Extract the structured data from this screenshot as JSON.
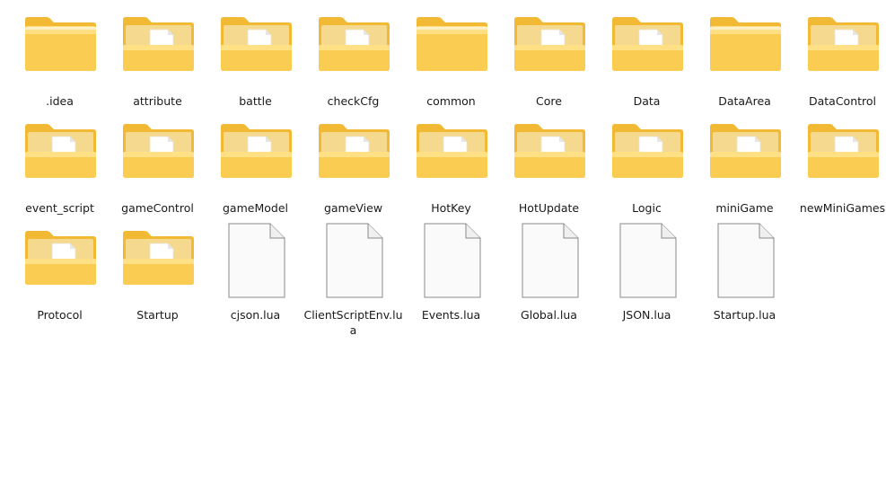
{
  "items": [
    {
      "name": ".idea",
      "type": "folder-empty"
    },
    {
      "name": "attribute",
      "type": "folder"
    },
    {
      "name": "battle",
      "type": "folder"
    },
    {
      "name": "checkCfg",
      "type": "folder"
    },
    {
      "name": "common",
      "type": "folder-empty"
    },
    {
      "name": "Core",
      "type": "folder"
    },
    {
      "name": "Data",
      "type": "folder"
    },
    {
      "name": "DataArea",
      "type": "folder-empty"
    },
    {
      "name": "DataControl",
      "type": "folder"
    },
    {
      "name": "event_script",
      "type": "folder"
    },
    {
      "name": "gameControl",
      "type": "folder"
    },
    {
      "name": "gameModel",
      "type": "folder"
    },
    {
      "name": "gameView",
      "type": "folder"
    },
    {
      "name": "HotKey",
      "type": "folder"
    },
    {
      "name": "HotUpdate",
      "type": "folder"
    },
    {
      "name": "Logic",
      "type": "folder"
    },
    {
      "name": "miniGame",
      "type": "folder"
    },
    {
      "name": "newMiniGames",
      "type": "folder"
    },
    {
      "name": "Protocol",
      "type": "folder"
    },
    {
      "name": "Startup",
      "type": "folder"
    },
    {
      "name": "cjson.lua",
      "type": "file"
    },
    {
      "name": "ClientScriptEnv.lua",
      "type": "file"
    },
    {
      "name": "Events.lua",
      "type": "file"
    },
    {
      "name": "Global.lua",
      "type": "file"
    },
    {
      "name": "JSON.lua",
      "type": "file"
    },
    {
      "name": "Startup.lua",
      "type": "file"
    }
  ],
  "colors": {
    "folder_back": "#F2B935",
    "folder_front_top": "#FFE28A",
    "folder_front_bottom": "#FBCC52",
    "folder_inner": "#F5D98E",
    "paper": "#FFFFFF",
    "file_outline": "#8A8A8A",
    "label_text": "#1A1A1A"
  },
  "icon_names": {
    "folder-empty": "folder-icon",
    "folder": "folder-with-files-icon",
    "file": "file-icon"
  }
}
